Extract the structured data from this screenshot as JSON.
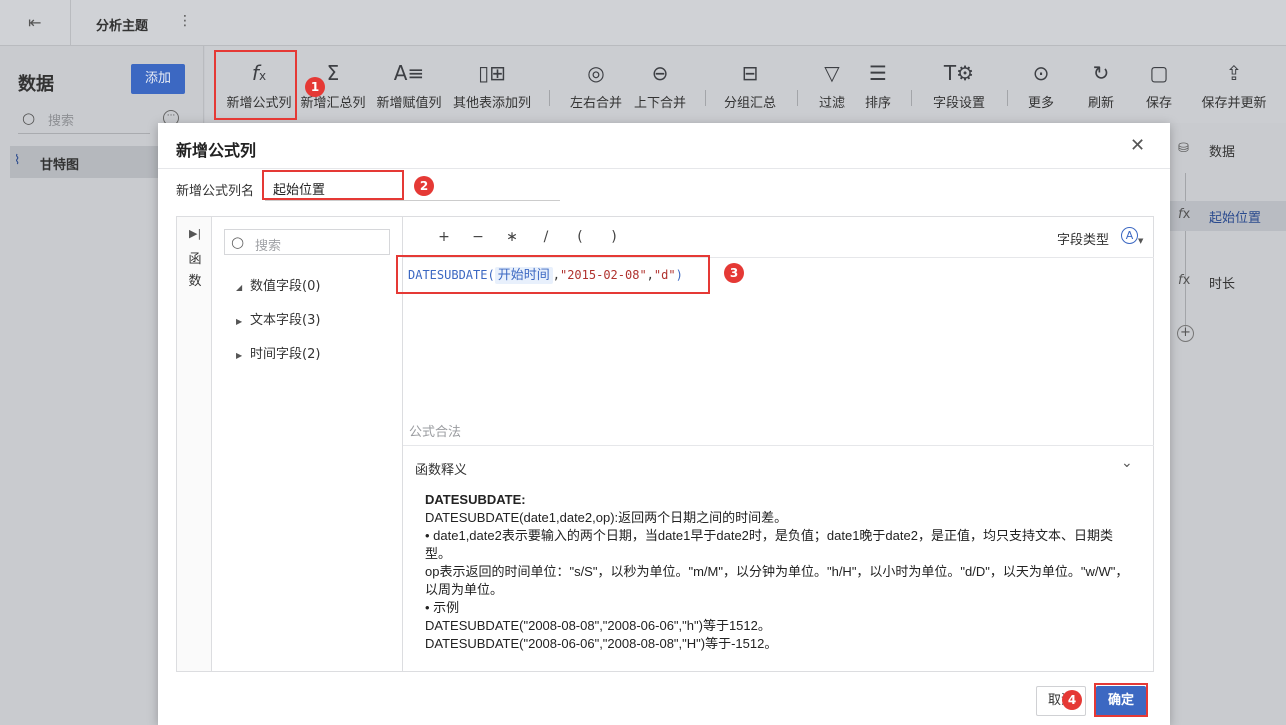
{
  "topbar": {
    "title": "分析主题"
  },
  "left_panel": {
    "heading": "数据",
    "add_label": "添加",
    "search_placeholder": "搜索",
    "items": [
      {
        "label": "甘特图"
      }
    ]
  },
  "toolbar": {
    "buttons": [
      {
        "label": "新增公式列",
        "icon": "fx-icon"
      },
      {
        "label": "新增汇总列",
        "icon": "sigma-icon"
      },
      {
        "label": "新增赋值列",
        "icon": "assign-icon"
      },
      {
        "label": "其他表添加列",
        "icon": "add-column-icon"
      },
      {
        "label": "左右合并",
        "icon": "merge-horizontal-icon"
      },
      {
        "label": "上下合并",
        "icon": "merge-vertical-icon"
      },
      {
        "label": "分组汇总",
        "icon": "group-icon"
      },
      {
        "label": "过滤",
        "icon": "filter-icon"
      },
      {
        "label": "排序",
        "icon": "sort-icon"
      },
      {
        "label": "字段设置",
        "icon": "field-settings-icon"
      },
      {
        "label": "更多",
        "icon": "more-icon"
      },
      {
        "label": "刷新",
        "icon": "refresh-icon"
      },
      {
        "label": "保存",
        "icon": "save-icon"
      },
      {
        "label": "保存并更新",
        "icon": "save-update-icon"
      }
    ]
  },
  "right_panel": {
    "steps": [
      {
        "label": "数据",
        "icon": "database-icon"
      },
      {
        "label": "起始位置",
        "icon": "fx-icon"
      },
      {
        "label": "时长",
        "icon": "fx-icon"
      }
    ]
  },
  "modal": {
    "title": "新增公式列",
    "name_label": "新增公式列名",
    "name_value": "起始位置",
    "function_tab": {
      "label": "函数"
    },
    "field_search_placeholder": "搜索",
    "field_groups": [
      {
        "label": "数值字段(0)",
        "expanded": true
      },
      {
        "label": "文本字段(3)",
        "expanded": false
      },
      {
        "label": "时间字段(2)",
        "expanded": false
      }
    ],
    "operators": [
      "+",
      "−",
      "∗",
      "/",
      "(",
      ")"
    ],
    "field_type_label": "字段类型",
    "formula": {
      "func": "DATESUBDATE",
      "field": "开始时间",
      "arg2": "\"2015-02-08\"",
      "arg3": "\"d\""
    },
    "validation": "公式合法",
    "explain_title": "函数释义",
    "explain": {
      "name": "DATESUBDATE:",
      "lines": [
        "DATESUBDATE(date1,date2,op):返回两个日期之间的时间差。",
        "• date1,date2表示要输入的两个日期，当date1早于date2时，是负值；date1晚于date2，是正值，均只支持文本、日期类型。",
        "op表示返回的时间单位：\"s/S\"，以秒为单位。\"m/M\"，以分钟为单位。\"h/H\"，以小时为单位。\"d/D\"，以天为单位。\"w/W\"，以周为单位。",
        "• 示例",
        "DATESUBDATE(\"2008-08-08\",\"2008-06-06\",\"h\")等于1512。",
        "DATESUBDATE(\"2008-06-06\",\"2008-08-08\",\"H\")等于-1512。"
      ]
    },
    "cancel_label": "取消",
    "ok_label": "确定"
  },
  "annotations": [
    "1",
    "2",
    "3",
    "4"
  ],
  "colors": {
    "accent": "#3c68c2",
    "annotation": "#e53935"
  }
}
